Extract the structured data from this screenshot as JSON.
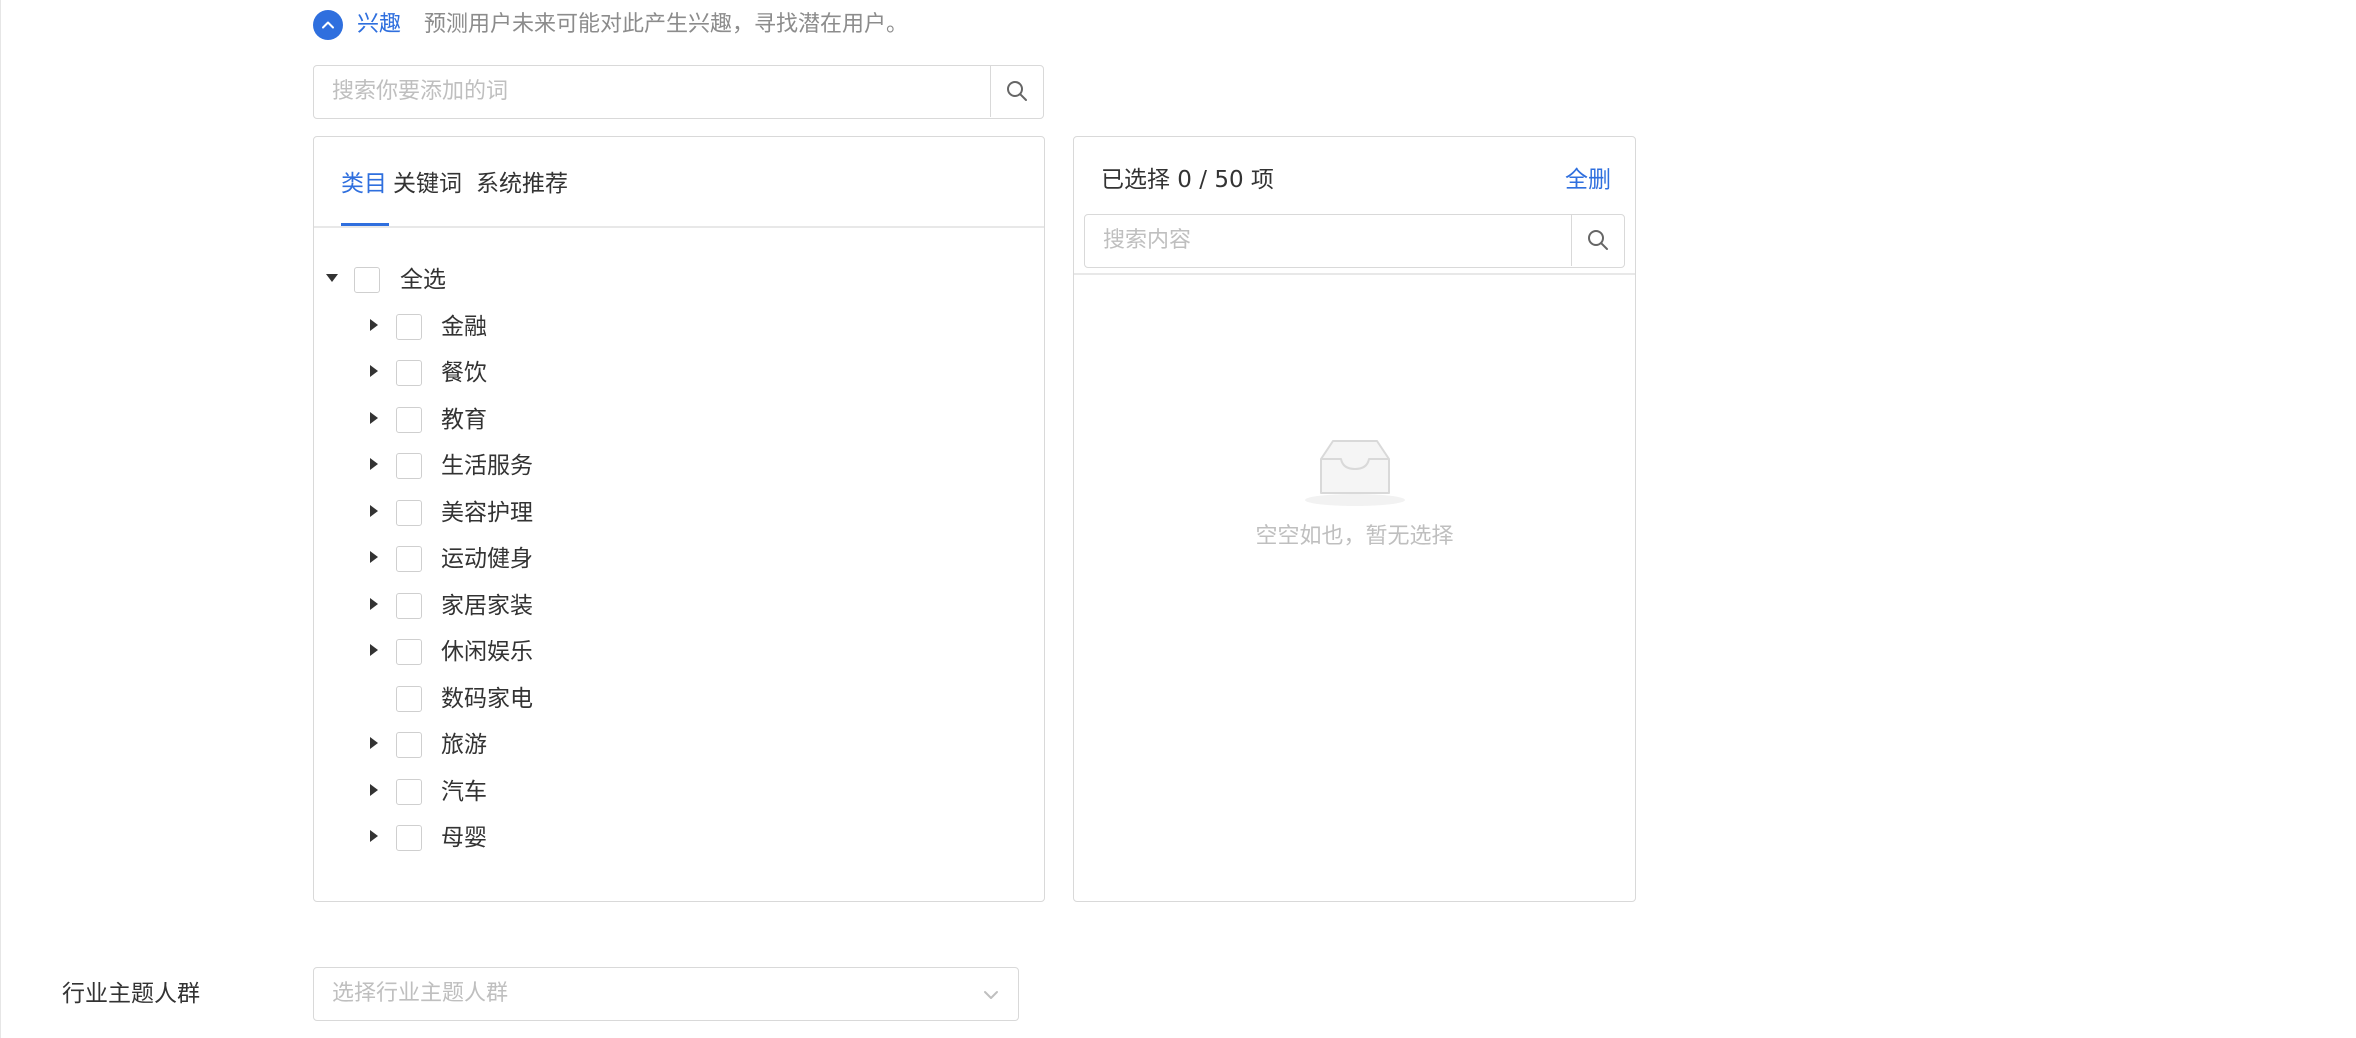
{
  "section": {
    "label": "兴趣",
    "description": "预测用户未来可能对此产生兴趣，寻找潜在用户。"
  },
  "search": {
    "placeholder": "搜索你要添加的词"
  },
  "tabs": [
    {
      "label": "类目",
      "active": true
    },
    {
      "label": "关键词",
      "active": false
    },
    {
      "label": "系统推荐",
      "active": false
    }
  ],
  "tree": {
    "root": {
      "label": "全选",
      "expanded": true,
      "checked": false
    },
    "children": [
      {
        "label": "金融",
        "has_children": true,
        "checked": false
      },
      {
        "label": "餐饮",
        "has_children": true,
        "checked": false
      },
      {
        "label": "教育",
        "has_children": true,
        "checked": false
      },
      {
        "label": "生活服务",
        "has_children": true,
        "checked": false
      },
      {
        "label": "美容护理",
        "has_children": true,
        "checked": false
      },
      {
        "label": "运动健身",
        "has_children": true,
        "checked": false
      },
      {
        "label": "家居家装",
        "has_children": true,
        "checked": false
      },
      {
        "label": "休闲娱乐",
        "has_children": true,
        "checked": false
      },
      {
        "label": "数码家电",
        "has_children": false,
        "checked": false
      },
      {
        "label": "旅游",
        "has_children": true,
        "checked": false
      },
      {
        "label": "汽车",
        "has_children": true,
        "checked": false
      },
      {
        "label": "母婴",
        "has_children": true,
        "checked": false
      }
    ]
  },
  "selected": {
    "count_text": "已选择 0 / 50 项",
    "clear_label": "全删",
    "search_placeholder": "搜索内容",
    "empty_text": "空空如也，暂无选择"
  },
  "industry_field": {
    "label": "行业主题人群",
    "placeholder": "选择行业主题人群"
  },
  "colors": {
    "accent": "#2f6fde",
    "border": "#d9d9d9",
    "placeholder": "#bfbfbf"
  }
}
